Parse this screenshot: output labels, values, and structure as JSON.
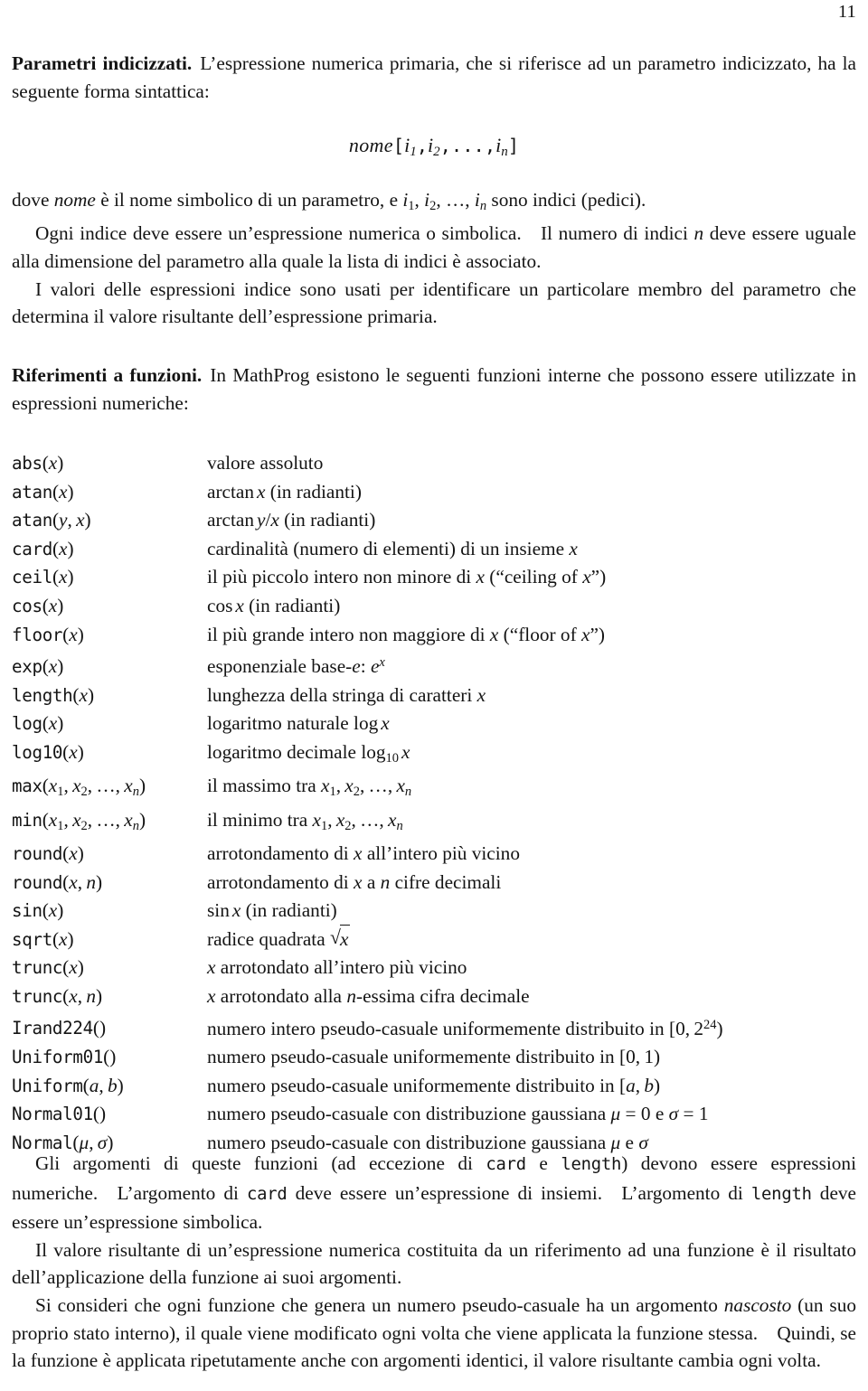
{
  "page": {
    "folio": "11"
  },
  "section_indexed_params": {
    "heading": "Parametri indicizzati.",
    "intro_after_heading": "L’espressione numerica primaria, che si riferisce ad un parametro indicizzato, ha la seguente forma sintattica:",
    "formula": {
      "name": "nome",
      "open_bracket": "[",
      "index_1": "i",
      "index_1_sub": "1",
      "comma_1": ",",
      "index_2": "i",
      "index_2_sub": "2",
      "comma_2": ",",
      "ellipsis": "...",
      "comma_3": ",",
      "index_n": "i",
      "index_n_sub": "n",
      "close_bracket": "]"
    },
    "para_dove_pre": "dove ",
    "para_dove_name": "nome",
    "para_dove_mid": " è il nome simbolico di un parametro, e ",
    "para_dove_i1": "i",
    "para_dove_i1sub": "1",
    "para_dove_sep1": ", ",
    "para_dove_i2": "i",
    "para_dove_i2sub": "2",
    "para_dove_sep2": ", …, ",
    "para_dove_in": "i",
    "para_dove_insub": "n",
    "para_dove_post": " sono indici (pedici).",
    "para_ogni_a": "Ogni indice deve essere un’espressione numerica o simbolica. Il numero di indici ",
    "para_ogni_n": "n",
    "para_ogni_b": " deve essere uguale alla dimensione del parametro alla quale la lista di indici è associato.",
    "para_valori": "I valori delle espressioni indice sono usati per identificare un particolare membro del parametro che determina il valore risultante dell’espressione primaria."
  },
  "section_functions": {
    "heading": "Riferimenti a funzioni.",
    "intro_after_heading": "In MathProg esistono le seguenti funzioni interne che possono essere utilizzate in espressioni numeriche:",
    "rows": [
      {
        "name": "abs",
        "args": "(x)",
        "desc": "valore assoluto"
      },
      {
        "name": "atan",
        "args": "(x)",
        "desc": "arctan x (in radianti)"
      },
      {
        "name": "atan",
        "args": "(y, x)",
        "desc": "arctan y/x (in radianti)"
      },
      {
        "name": "card",
        "args": "(x)",
        "desc": "cardinalità (numero di elementi) di un insieme x"
      },
      {
        "name": "ceil",
        "args": "(x)",
        "desc": "il più piccolo intero non minore di x (“ceiling of x”)"
      },
      {
        "name": "cos",
        "args": "(x)",
        "desc": "cos x (in radianti)"
      },
      {
        "name": "floor",
        "args": "(x)",
        "desc": "il più grande intero non maggiore di x (“floor of x”)"
      },
      {
        "name": "exp",
        "args": "(x)",
        "desc": "esponenziale base-e: e^x"
      },
      {
        "name": "length",
        "args": "(x)",
        "desc": "lunghezza della stringa di caratteri x"
      },
      {
        "name": "log",
        "args": "(x)",
        "desc": "logaritmo naturale log x"
      },
      {
        "name": "log10",
        "args": "(x)",
        "desc": "logaritmo decimale log10 x"
      },
      {
        "name": "max",
        "args": "(x1, x2, …, xn)",
        "desc": "il massimo tra x1, x2, …, xn"
      },
      {
        "name": "min",
        "args": "(x1, x2, …, xn)",
        "desc": "il minimo tra x1, x2, …, xn"
      },
      {
        "name": "round",
        "args": "(x)",
        "desc": "arrotondamento di x all’intero più vicino"
      },
      {
        "name": "round",
        "args": "(x, n)",
        "desc": "arrotondamento di x a n cifre decimali"
      },
      {
        "name": "sin",
        "args": "(x)",
        "desc": "sin x (in radianti)"
      },
      {
        "name": "sqrt",
        "args": "(x)",
        "desc": "radice quadrata √x"
      },
      {
        "name": "trunc",
        "args": "(x)",
        "desc": "x arrotondato all’intero più vicino"
      },
      {
        "name": "trunc",
        "args": "(x, n)",
        "desc": "x arrotondato alla n-essima cifra decimale"
      },
      {
        "name": "Irand224",
        "args": "()",
        "desc": "numero intero pseudo-casuale uniformemente distribuito in [0, 2^24)"
      },
      {
        "name": "Uniform01",
        "args": "()",
        "desc": "numero pseudo-casuale uniformemente distribuito in [0, 1)"
      },
      {
        "name": "Uniform",
        "args": "(a, b)",
        "desc": "numero pseudo-casuale uniformemente distribuito in [a, b)"
      },
      {
        "name": "Normal01",
        "args": "()",
        "desc": "numero pseudo-casuale con distribuzione gaussiana μ = 0 e σ = 1"
      },
      {
        "name": "Normal",
        "args": "(μ, σ)",
        "desc": "numero pseudo-casuale con distribuzione gaussiana μ e σ"
      }
    ]
  },
  "tail": {
    "para_args_1": "Gli argomenti di queste funzioni (ad eccezione di ",
    "para_args_card1": "card",
    "para_args_2": " e ",
    "para_args_length1": "length",
    "para_args_3": ") devono essere espressioni numeriche. L’argomento di ",
    "para_args_card2": "card",
    "para_args_4": " deve essere un’espressione di insiemi. L’argomento di ",
    "para_args_length2": "length",
    "para_args_5": " deve essere un’espressione simbolica.",
    "para_valore": "Il valore risultante di un’espressione numerica costituita da un riferimento ad una funzione è il risultato dell’applicazione della funzione ai suoi argomenti.",
    "para_consideri_1": "Si consideri che ogni funzione che genera un numero pseudo-casuale ha un argomento ",
    "para_consideri_em": "nascosto",
    "para_consideri_2": " (un suo proprio stato interno), il quale viene modificato ogni volta che viene applicata la funzione stessa. Quindi, se la funzione è applicata ripetutamente anche con argomenti identici, il valore risultante cambia ogni volta."
  }
}
